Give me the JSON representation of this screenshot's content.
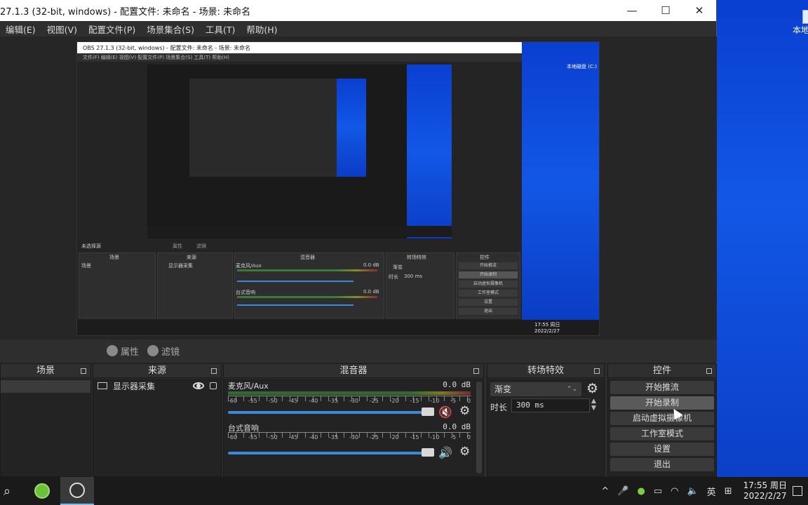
{
  "window": {
    "title": "27.1.3 (32-bit, windows) - 配置文件: 未命名 - 场景: 未命名",
    "controls": {
      "minimize": "—",
      "maximize": "☐",
      "close": "✕"
    }
  },
  "menu": [
    "编辑(E)",
    "视图(V)",
    "配置文件(P)",
    "场景集合(S)",
    "工具(T)",
    "帮助(H)"
  ],
  "desktop": {
    "icon_label": "本地"
  },
  "preview": {
    "nested_title": "OBS 27.1.3 (32-bit, windows) - 配置文件: 未命名 - 场景: 未命名",
    "nested_menu": "文件(F)   编辑(E)   视图(V)   配置文件(P)   场景集合(S)   工具(T)   帮助(H)",
    "nested_desktop_icon": "本地磁盘 (C:)",
    "nested_no_source": "未选择源",
    "nested_props": "属性",
    "nested_filters": "滤镜",
    "nested_scene_header": "场景",
    "nested_scene_item": "场景",
    "nested_source_header": "来源",
    "nested_source_item": "显示器采集",
    "nested_mixer_header": "混音器",
    "nested_mic": "麦克风/Aux",
    "nested_desktop_audio": "台式音响",
    "nested_db": "0.0 dB",
    "nested_trans_header": "转场特效",
    "nested_trans": "渐变",
    "nested_duration": "时长",
    "nested_duration_val": "300 ms",
    "nested_controls_header": "控件",
    "nested_controls": [
      "开始推流",
      "开始录制",
      "启动虚拟摄像机",
      "工作室模式",
      "设置",
      "退出"
    ],
    "nested_clock_time": "17:55 周日",
    "nested_clock_date": "2022/2/27"
  },
  "source_toolbar": {
    "properties": "属性",
    "filters": "滤镜"
  },
  "docks": {
    "scenes": {
      "title": "场景"
    },
    "sources": {
      "title": "来源",
      "items": [
        {
          "label": "显示器采集"
        }
      ]
    },
    "mixer": {
      "title": "混音器",
      "scale": [
        "-60",
        "-55",
        "-50",
        "-45",
        "-40",
        "-35",
        "-30",
        "-25",
        "-20",
        "-15",
        "-10",
        "-5",
        "0"
      ],
      "channels": [
        {
          "name": "麦克风/Aux",
          "db": "0.0 dB",
          "muted": true
        },
        {
          "name": "台式音响",
          "db": "0.0 dB",
          "muted": false
        }
      ]
    },
    "transitions": {
      "title": "转场特效",
      "selected": "渐变",
      "duration_label": "时长",
      "duration_value": "300 ms"
    },
    "controls": {
      "title": "控件",
      "buttons": [
        "开始推流",
        "开始录制",
        "启动虚拟摄像机",
        "工作室模式",
        "设置",
        "退出"
      ]
    }
  },
  "taskbar": {
    "tray": [
      "^",
      "🎤",
      "●",
      "▭",
      "◠",
      "🔈",
      "英",
      "⊞"
    ],
    "clock_time": "17:55 周日",
    "clock_date": "2022/2/27"
  }
}
